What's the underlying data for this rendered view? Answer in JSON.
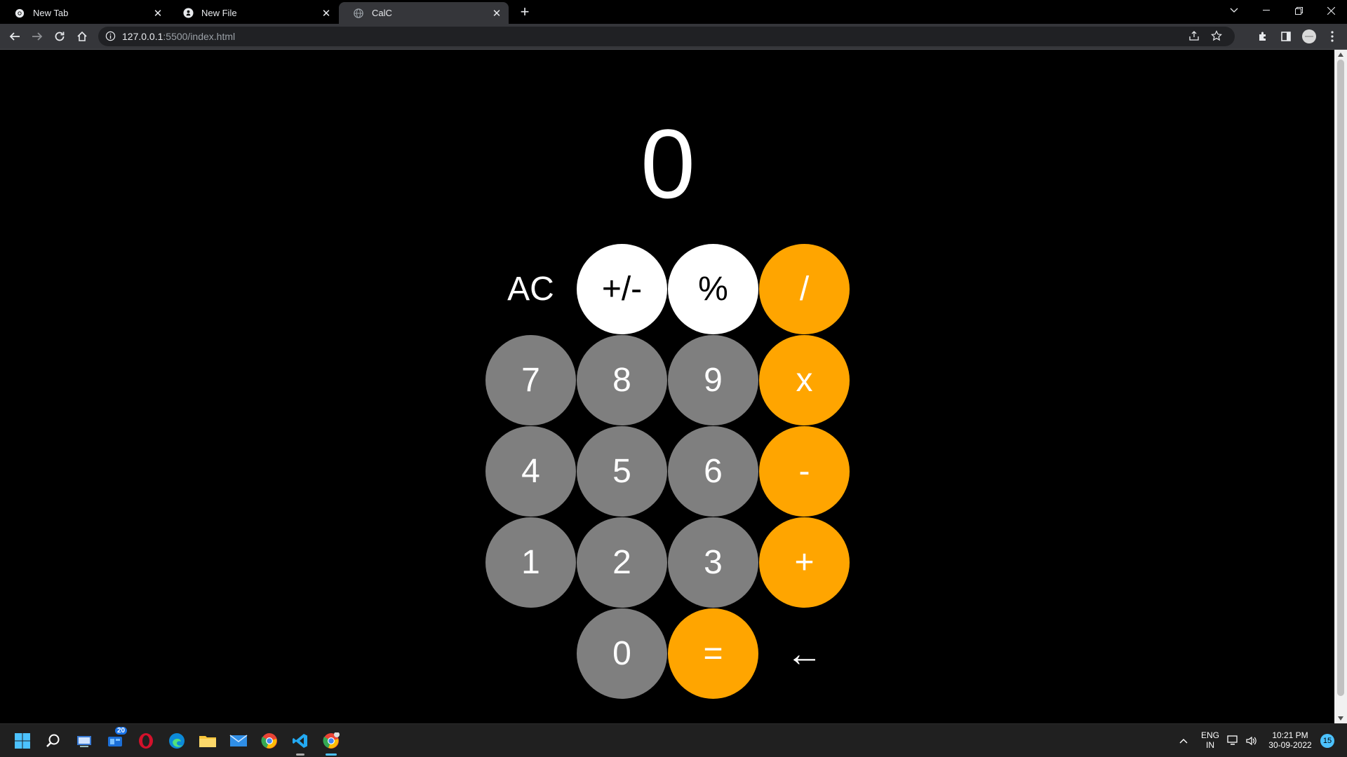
{
  "browser": {
    "tabs": [
      {
        "title": "New Tab",
        "icon": "chrome-icon",
        "active": false
      },
      {
        "title": "New File",
        "icon": "github-icon",
        "active": false
      },
      {
        "title": "CalC",
        "icon": "globe-icon",
        "active": true
      }
    ],
    "url_host": "127.0.0.1",
    "url_path": ":5500/index.html"
  },
  "calculator": {
    "display": "0",
    "keys": {
      "ac": "AC",
      "plusminus": "+/-",
      "percent": "%",
      "divide": "/",
      "seven": "7",
      "eight": "8",
      "nine": "9",
      "multiply": "x",
      "four": "4",
      "five": "5",
      "six": "6",
      "minus": "-",
      "one": "1",
      "two": "2",
      "three": "3",
      "plus": "+",
      "zero": "0",
      "equals": "=",
      "backspace": "←"
    },
    "colors": {
      "digit": "#7f7f7f",
      "operator": "#ffa500",
      "function": "#ffffff"
    }
  },
  "taskbar": {
    "widgets_badge": "20",
    "language_primary": "ENG",
    "language_secondary": "IN",
    "time": "10:21 PM",
    "date": "30-09-2022",
    "notification_count": "15"
  }
}
